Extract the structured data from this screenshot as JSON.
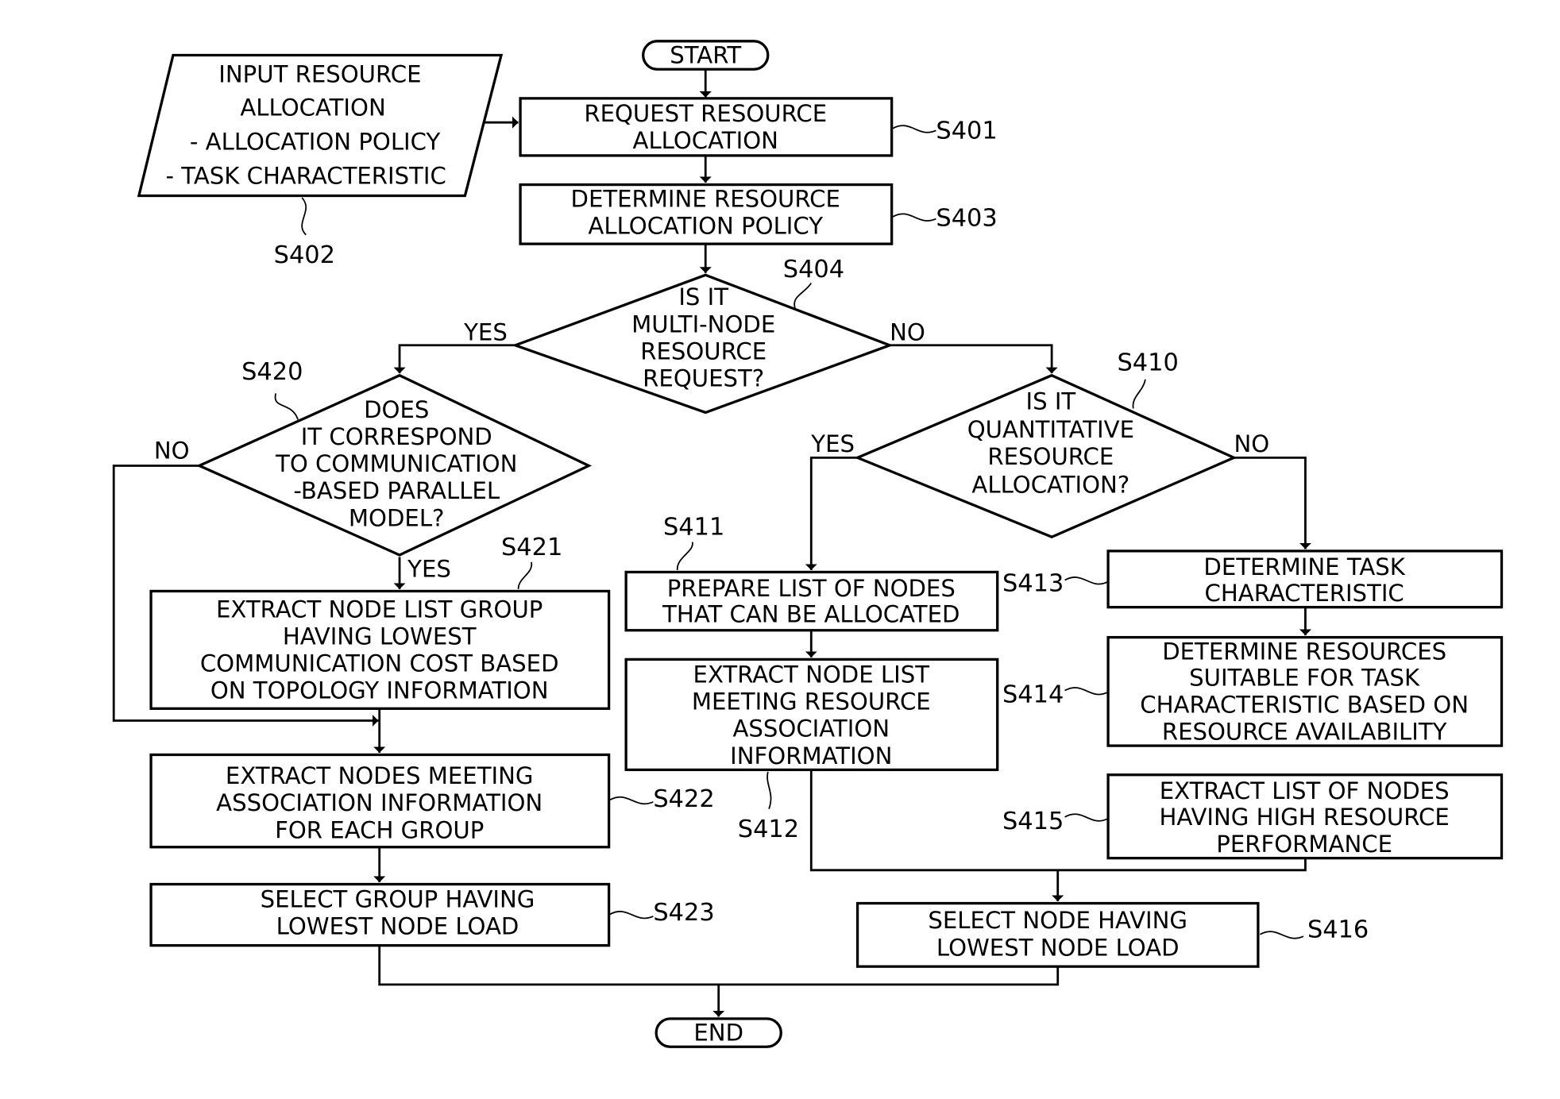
{
  "diagram": {
    "type": "flowchart",
    "colors": {
      "stroke": "#000000",
      "background": "#ffffff"
    },
    "terminals": {
      "start": "START",
      "end": "END"
    },
    "nodes": [
      {
        "id": "S401",
        "kind": "process",
        "step_label": "S401",
        "lines": [
          "REQUEST RESOURCE",
          "ALLOCATION"
        ]
      },
      {
        "id": "S402",
        "kind": "input",
        "step_label": "S402",
        "lines": [
          "INPUT RESOURCE",
          "ALLOCATION",
          "- ALLOCATION POLICY",
          "- TASK CHARACTERISTIC"
        ]
      },
      {
        "id": "S403",
        "kind": "process",
        "step_label": "S403",
        "lines": [
          "DETERMINE RESOURCE",
          "ALLOCATION POLICY"
        ]
      },
      {
        "id": "S404",
        "kind": "decision",
        "step_label": "S404",
        "lines": [
          "IS IT",
          "MULTI-NODE",
          "RESOURCE",
          "REQUEST?"
        ]
      },
      {
        "id": "S410",
        "kind": "decision",
        "step_label": "S410",
        "lines": [
          "IS IT",
          "QUANTITATIVE",
          "RESOURCE",
          "ALLOCATION?"
        ]
      },
      {
        "id": "S411",
        "kind": "process",
        "step_label": "S411",
        "lines": [
          "PREPARE LIST OF NODES",
          "THAT CAN BE ALLOCATED"
        ]
      },
      {
        "id": "S412",
        "kind": "process",
        "step_label": "S412",
        "lines": [
          "EXTRACT NODE LIST",
          "MEETING RESOURCE",
          "ASSOCIATION",
          "INFORMATION"
        ]
      },
      {
        "id": "S413",
        "kind": "process",
        "step_label": "S413",
        "lines": [
          "DETERMINE TASK",
          "CHARACTERISTIC"
        ]
      },
      {
        "id": "S414",
        "kind": "process",
        "step_label": "S414",
        "lines": [
          "DETERMINE RESOURCES",
          "SUITABLE FOR TASK",
          "CHARACTERISTIC BASED ON",
          "RESOURCE AVAILABILITY"
        ]
      },
      {
        "id": "S415",
        "kind": "process",
        "step_label": "S415",
        "lines": [
          "EXTRACT LIST OF NODES",
          "HAVING HIGH RESOURCE",
          "PERFORMANCE"
        ]
      },
      {
        "id": "S416",
        "kind": "process",
        "step_label": "S416",
        "lines": [
          "SELECT NODE HAVING",
          "LOWEST NODE LOAD"
        ]
      },
      {
        "id": "S420",
        "kind": "decision",
        "step_label": "S420",
        "lines": [
          "DOES",
          "IT CORRESPOND",
          "TO COMMUNICATION",
          "-BASED PARALLEL",
          "MODEL?"
        ]
      },
      {
        "id": "S421",
        "kind": "process",
        "step_label": "S421",
        "lines": [
          "EXTRACT NODE LIST GROUP",
          "HAVING LOWEST",
          "COMMUNICATION COST BASED",
          "ON TOPOLOGY INFORMATION"
        ]
      },
      {
        "id": "S422",
        "kind": "process",
        "step_label": "S422",
        "lines": [
          "EXTRACT NODES MEETING",
          "ASSOCIATION INFORMATION",
          "FOR EACH GROUP"
        ]
      },
      {
        "id": "S423",
        "kind": "process",
        "step_label": "S423",
        "lines": [
          "SELECT GROUP HAVING",
          "LOWEST NODE LOAD"
        ]
      }
    ],
    "branch_labels": {
      "s404_yes": "YES",
      "s404_no": "NO",
      "s410_yes": "YES",
      "s410_no": "NO",
      "s420_yes": "YES",
      "s420_no": "NO"
    },
    "edges": [
      [
        "START",
        "S401"
      ],
      [
        "S402",
        "S401"
      ],
      [
        "S401",
        "S403"
      ],
      [
        "S403",
        "S404"
      ],
      [
        "S404",
        "S420",
        "YES"
      ],
      [
        "S404",
        "S410",
        "NO"
      ],
      [
        "S420",
        "S421",
        "YES"
      ],
      [
        "S420",
        "S422",
        "NO"
      ],
      [
        "S421",
        "S422"
      ],
      [
        "S422",
        "S423"
      ],
      [
        "S410",
        "S411",
        "YES"
      ],
      [
        "S410",
        "S413",
        "NO"
      ],
      [
        "S411",
        "S412"
      ],
      [
        "S413",
        "S414"
      ],
      [
        "S412",
        "S416"
      ],
      [
        "S415",
        "S416"
      ],
      [
        "S423",
        "END"
      ],
      [
        "S416",
        "END"
      ]
    ]
  }
}
